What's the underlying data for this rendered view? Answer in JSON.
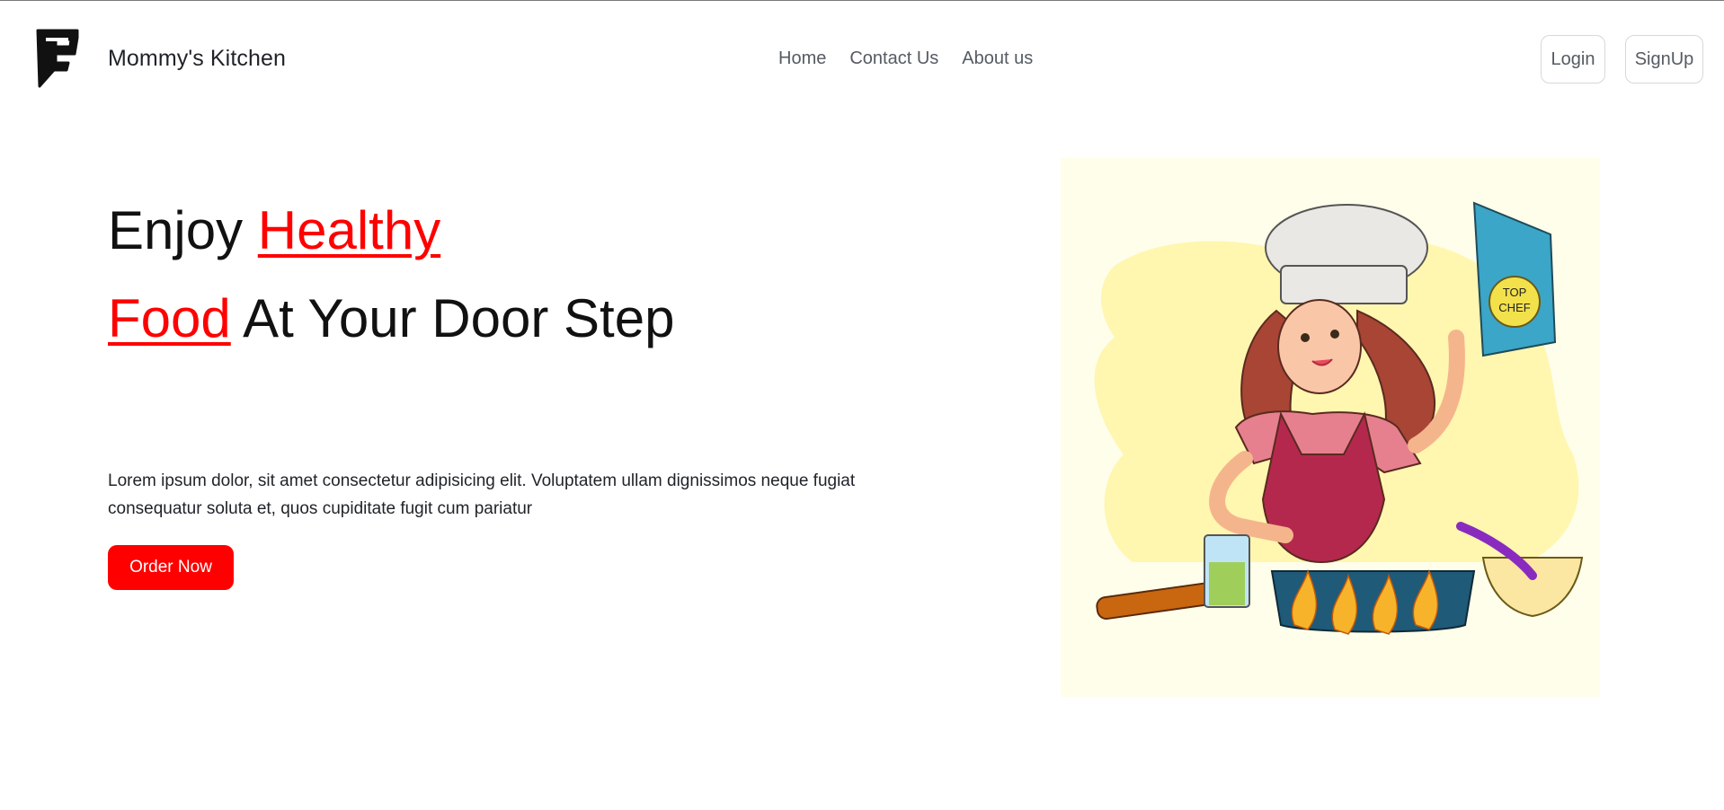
{
  "navbar": {
    "brand": "Mommy's Kitchen",
    "links": [
      "Home",
      "Contact Us",
      "About us"
    ],
    "login_label": "Login",
    "signup_label": "SignUp"
  },
  "hero": {
    "title_part1": "Enjoy ",
    "title_accent1": "Healthy",
    "title_accent2": "Food",
    "title_part2": " At Your Door Step",
    "description": "Lorem ipsum dolor, sit amet consectetur adipisicing elit. Voluptatem ullam dignissimos neque fugiat consequatur soluta et, quos cupiditate fugit cum pariatur",
    "cta_label": "Order Now"
  },
  "illustration": {
    "book_text": [
      "TOP",
      "CHEF"
    ]
  },
  "colors": {
    "accent": "#ff0000",
    "illustration_bg": "#fffeea",
    "blob": "#fff6b0"
  }
}
